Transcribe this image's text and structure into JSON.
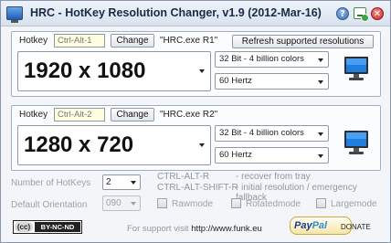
{
  "window": {
    "title": "HRC - HotKey Resolution Changer, v1.9 (2012-Mar-16)"
  },
  "titlebar_buttons": {
    "help": "?"
  },
  "profiles": [
    {
      "hotkey_label": "Hotkey",
      "hotkey_value": "Ctrl-Alt-1",
      "change_label": "Change",
      "name": "\"HRC.exe R1\"",
      "refresh_label": "Refresh supported resolutions",
      "resolution": "1920 x 1080",
      "color_depth": "32 Bit - 4 billion colors",
      "refresh_rate": "60 Hertz"
    },
    {
      "hotkey_label": "Hotkey",
      "hotkey_value": "Ctrl-Alt-2",
      "change_label": "Change",
      "name": "\"HRC.exe R2\"",
      "resolution": "1280 x 720",
      "color_depth": "32 Bit - 4 billion colors",
      "refresh_rate": "60 Hertz"
    }
  ],
  "settings": {
    "num_hotkeys_label": "Number of HotKeys",
    "num_hotkeys_value": "2",
    "default_orientation_label": "Default Orientation",
    "default_orientation_value": "090",
    "hint1_keys": "CTRL-ALT-R",
    "hint1_desc": "- recover from tray",
    "hint2_keys": "CTRL-ALT-SHIFT-R",
    "hint2_desc": "- initial resolution / emergency fallback",
    "rawmode_label": "Rawmode",
    "rotatedmode_label": "Rotatedmode",
    "largemode_label": "Largemode"
  },
  "footer": {
    "license_cc": "(cc)",
    "license_text": "BY-NC-ND",
    "support_text": "For support visit",
    "support_link": "http://www.funk.eu",
    "paypal_part1": "Pay",
    "paypal_part2": "Pal",
    "donate_label": "DONATE"
  },
  "colors": {
    "hotkey_field_bg": "#fffde0",
    "titlebar": "#dce5f0",
    "disabled_text": "#9aa2ac"
  }
}
